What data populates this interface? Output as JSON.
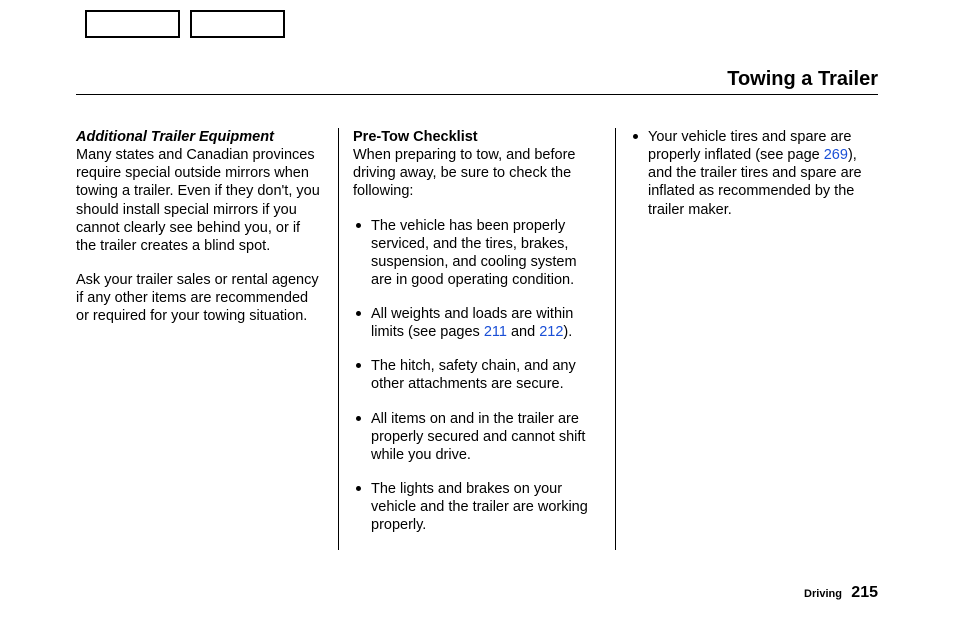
{
  "header": {
    "title": "Towing a Trailer"
  },
  "footer": {
    "section": "Driving",
    "page": "215"
  },
  "col1": {
    "h1": "Additional  Trailer Equipment",
    "p1": "Many states and Canadian provinces require special outside mirrors when towing a trailer. Even if they don't, you should install special mirrors if you cannot clearly see behind you, or if the trailer creates a blind spot.",
    "p2": "Ask your trailer sales or rental agency if any other items are recommended or required for your towing situation."
  },
  "col2": {
    "h1": "Pre-Tow Checklist",
    "intro": "When preparing to tow, and before driving away, be sure to check the following:",
    "items": {
      "i0": "The vehicle has been properly serviced, and the tires, brakes, suspension, and cooling system are in good operating condition.",
      "i1a": "All weights and loads are within limits (see pages ",
      "i1link1": "211",
      "i1b": " and ",
      "i1link2": "212",
      "i1c": ").",
      "i2": "The hitch, safety chain, and any other attachments are secure.",
      "i3": "All items on and in the trailer are properly secured and cannot shift while you drive.",
      "i4": "The lights and brakes on your vehicle and the trailer are working properly."
    }
  },
  "col3": {
    "i0a": "Your vehicle tires and spare are properly inflated (see page ",
    "i0link": "269",
    "i0b": "), and the trailer tires and spare are inflated as recommended by the trailer maker."
  }
}
